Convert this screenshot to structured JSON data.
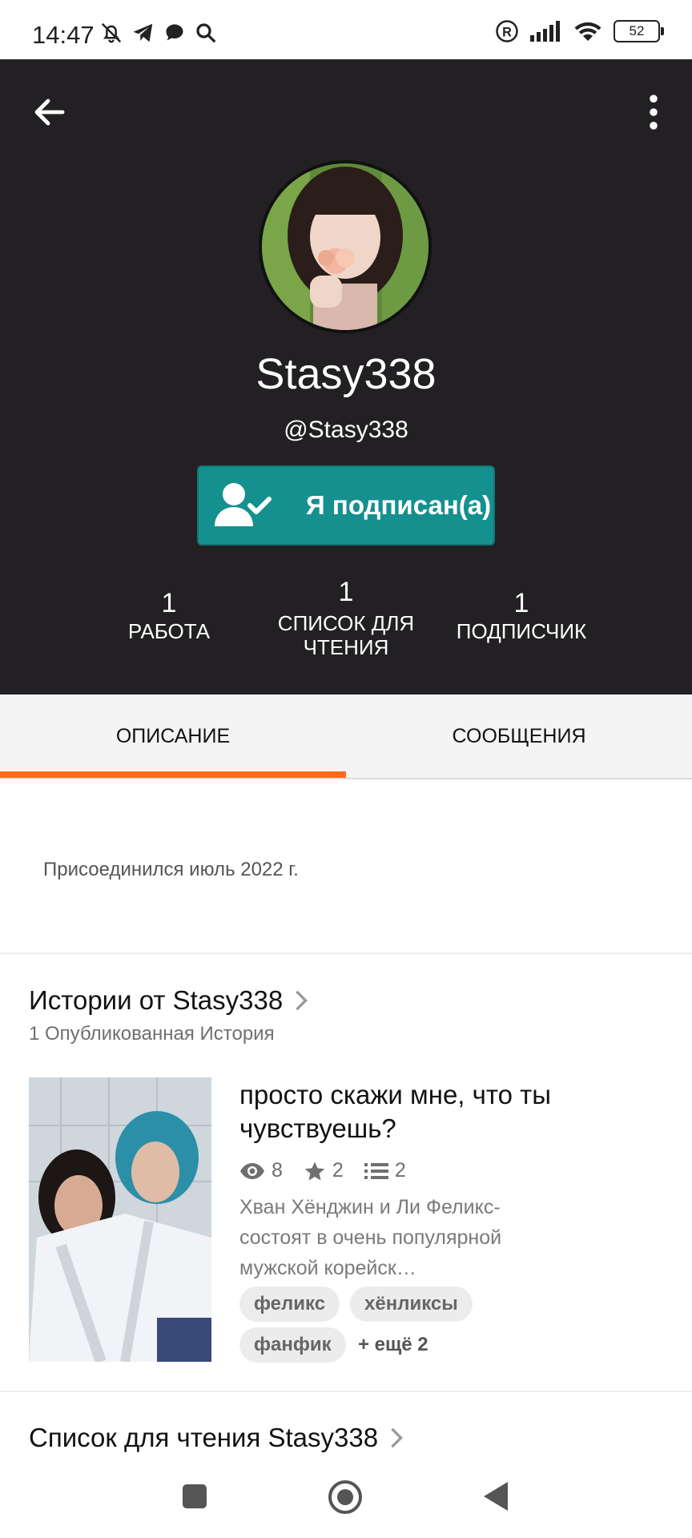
{
  "status_bar": {
    "time": "14:47",
    "battery": "52",
    "icons": [
      "bell-off-icon",
      "telegram-icon",
      "chat-bubble-icon",
      "search-icon",
      "registered-icon",
      "signal-icon",
      "wifi-icon",
      "battery-icon"
    ]
  },
  "header": {
    "back_icon": "arrow-left-icon",
    "more_icon": "more-vertical-icon",
    "display_name": "Stasy338",
    "username": "@Stasy338",
    "follow_button_label": "Я подписан(а)",
    "stats": [
      {
        "value": "1",
        "label_lines": [
          "РАБОТА"
        ]
      },
      {
        "value": "1",
        "label_lines": [
          "СПИСОК ДЛЯ",
          "ЧТЕНИЯ"
        ]
      },
      {
        "value": "1",
        "label_lines": [
          "ПОДПИСЧИК"
        ]
      }
    ]
  },
  "tabs": {
    "about": "ОПИСАНИЕ",
    "messages": "СООБЩЕНИЯ",
    "active": "about"
  },
  "about": {
    "joined": "Присоединился июль 2022 г."
  },
  "stories_section": {
    "title": "Истории от Stasy338",
    "subtitle": "1 Опубликованная История",
    "story": {
      "title": "просто скажи мне, что ты чувствуешь?",
      "views": "8",
      "votes": "2",
      "parts": "2",
      "description": "Хван Хёнджин и Ли Феликс-состоят в очень популярной мужской корейск…",
      "tags": [
        "феликс",
        "хёнликсы",
        "фанфик"
      ],
      "more_tags": "+ ещё 2"
    }
  },
  "reading_list_section": {
    "title": "Список для чтения Stasy338"
  },
  "colors": {
    "header_bg": "#222023",
    "follow_button": "#14908f",
    "tab_indicator": "#ff6a1a"
  }
}
